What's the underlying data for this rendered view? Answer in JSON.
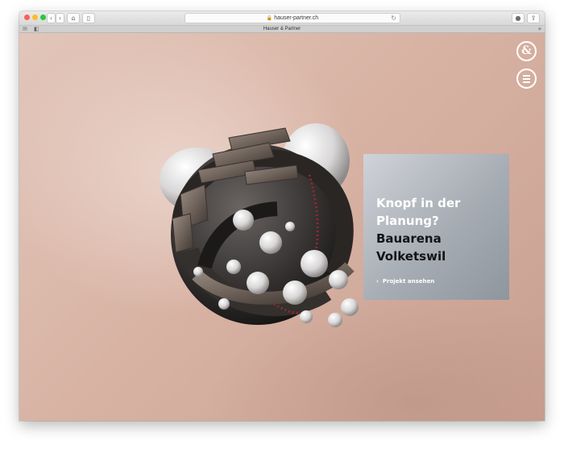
{
  "browser": {
    "url": "hauser-partner.ch",
    "tab_title": "Hauser & Partner",
    "nav": {
      "back": "‹",
      "forward": "›",
      "home": "⌂",
      "sidebar": "▯",
      "reload": "↻",
      "lock": "🔒",
      "extension": "●",
      "share": "⇪",
      "new_tab": "+"
    },
    "tab_icons": {
      "mail": "✉",
      "pinned": "◧"
    }
  },
  "page": {
    "logo_glyph": "&",
    "project": {
      "title_lines": [
        {
          "text": "Knopf in der",
          "tone": "light"
        },
        {
          "text": "Planung?",
          "tone": "light"
        },
        {
          "text": "Bauarena",
          "tone": "dark"
        },
        {
          "text": "Volketswil",
          "tone": "dark"
        }
      ],
      "link_label": "Projekt ansehen",
      "link_chevron": "›"
    },
    "colors": {
      "background": "#d8b2a3",
      "card": "#a6acb3",
      "title_light": "#ffffff",
      "title_dark": "#111418"
    }
  }
}
